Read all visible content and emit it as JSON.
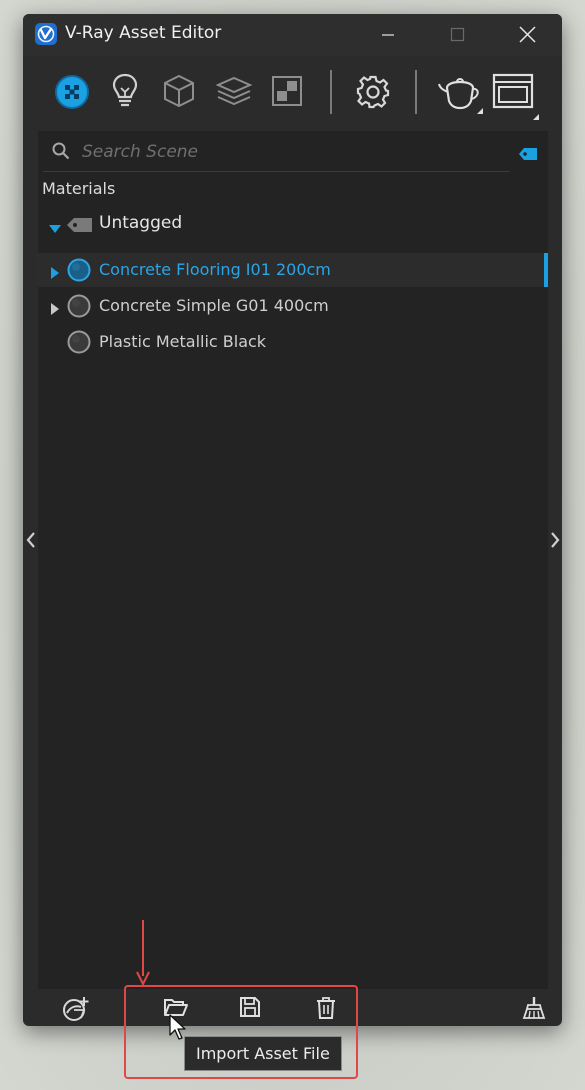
{
  "window": {
    "title": "V-Ray Asset Editor"
  },
  "toolbar": {
    "icons": [
      "materials-icon",
      "lights-icon",
      "geometry-icon",
      "layers-icon",
      "textures-icon",
      "settings-icon",
      "render-teapot-icon",
      "frame-buffer-icon"
    ],
    "accent": "#1ba1e2"
  },
  "search": {
    "placeholder": "Search Scene"
  },
  "materials": {
    "section_title": "Materials",
    "group": {
      "label": "Untagged",
      "items": [
        {
          "label": "Concrete Flooring I01 200cm",
          "selected": true,
          "expandable": true
        },
        {
          "label": "Concrete Simple G01 400cm",
          "selected": false,
          "expandable": true
        },
        {
          "label": "Plastic Metallic Black",
          "selected": false,
          "expandable": false
        }
      ]
    }
  },
  "bottom_toolbar": {
    "icons": [
      "add-material-icon",
      "import-folder-icon",
      "save-icon",
      "delete-icon",
      "purge-broom-icon"
    ]
  },
  "tooltip": {
    "text": "Import Asset File"
  },
  "annotation": {
    "color": "#e04848"
  }
}
